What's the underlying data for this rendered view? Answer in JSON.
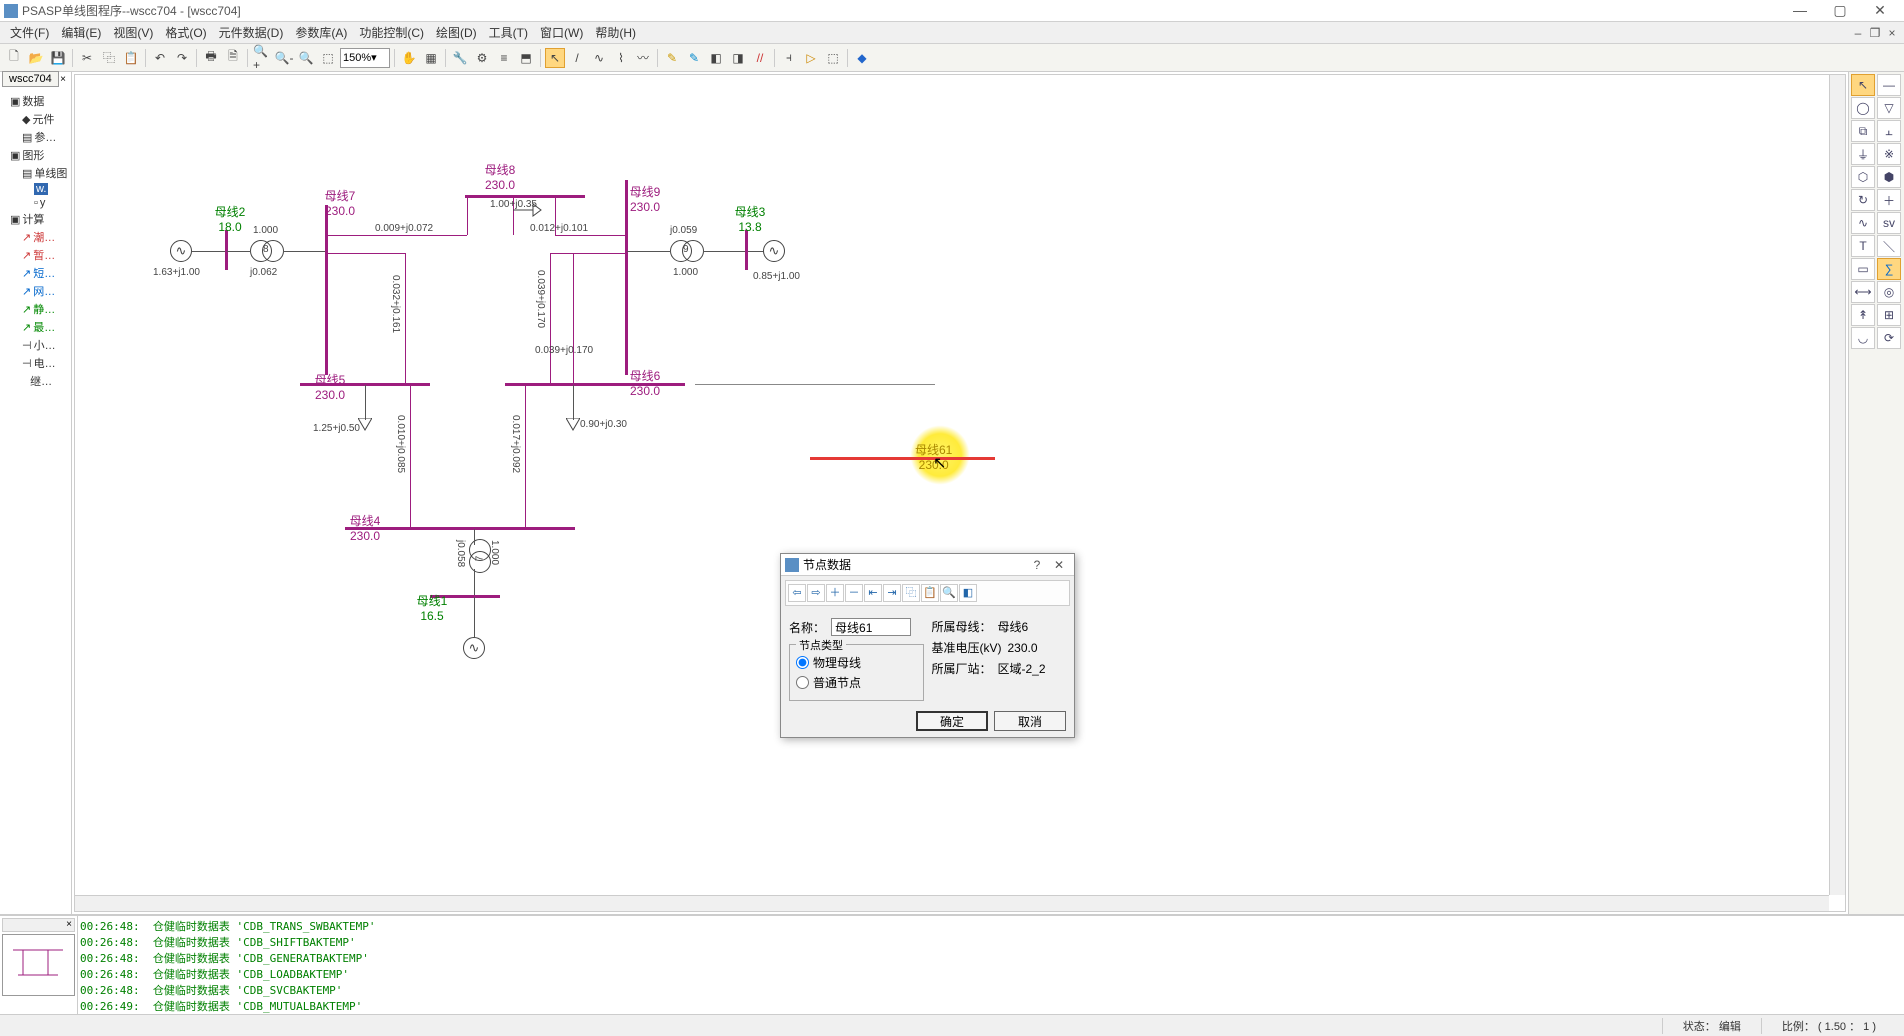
{
  "title": "PSASP单线图程序--wscc704 - [wscc704]",
  "menu": [
    "文件(F)",
    "编辑(E)",
    "视图(V)",
    "格式(O)",
    "元件数据(D)",
    "参数库(A)",
    "功能控制(C)",
    "绘图(D)",
    "工具(T)",
    "窗口(W)",
    "帮助(H)"
  ],
  "zoom": "150%",
  "sidebar_tab": "wscc704",
  "tree": {
    "n_data": "数据",
    "n_yuanjian": "元件",
    "n_can": "参…",
    "n_tuxing": "图形",
    "n_danxian": "单线图",
    "n_w": "w.",
    "n_y": "y",
    "n_jisuan": "计算",
    "leaf1": "潮…",
    "leaf2": "暂…",
    "leaf3": "短…",
    "leaf4": "网…",
    "leaf5": "静…",
    "leaf6": "最…",
    "leaf7": "小…",
    "leaf8": "电…",
    "leaf9": "继…"
  },
  "buses": {
    "b1": {
      "name": "母线1",
      "v": "16.5"
    },
    "b2": {
      "name": "母线2",
      "v": "18.0"
    },
    "b3": {
      "name": "母线3",
      "v": "13.8"
    },
    "b4": {
      "name": "母线4",
      "v": "230.0"
    },
    "b5": {
      "name": "母线5",
      "v": "230.0"
    },
    "b6": {
      "name": "母线6",
      "v": "230.0"
    },
    "b7": {
      "name": "母线7",
      "v": "230.0"
    },
    "b8": {
      "name": "母线8",
      "v": "230.0"
    },
    "b9": {
      "name": "母线9",
      "v": "230.0"
    },
    "b61": {
      "name": "母线61",
      "v": "230.0"
    }
  },
  "labels": {
    "g2": "1.63+j1.00",
    "g3": "0.85+j1.00",
    "x8": "j0.062",
    "x8u": "1.000",
    "x9": "j0.059",
    "x9u": "1.000",
    "x7": "j0.058",
    "x7u": "1.000",
    "ln78": "0.009+j0.072",
    "ln89_a": "1.00+j0.35",
    "ln89": "0.012+j0.101",
    "ln75": "0.032+j0.161",
    "ln96a": "0.039+j0.170",
    "ln96b": "0.039+j0.170",
    "ln54": "0.010+j0.085",
    "ln64": "0.017+j0.092",
    "ld5": "1.25+j0.50",
    "ld6": "0.90+j0.30",
    "t8": "8",
    "t9": "9",
    "t7": "7"
  },
  "dialog": {
    "title": "节点数据",
    "name_lbl": "名称：",
    "name_val": "母线61",
    "group": "节点类型",
    "opt1": "物理母线",
    "opt2": "普通节点",
    "bus_lbl": "所属母线：",
    "bus_val": "母线6",
    "kv_lbl": "基准电压(kV)",
    "kv_val": "230.0",
    "area_lbl": "所属厂站：",
    "area_val": "区域-2_2",
    "ok": "确定",
    "cancel": "取消"
  },
  "log": [
    "00:26:48:  仓健临时数据表 'CDB_TRANS_SWBAKTEMP'",
    "00:26:48:  仓健临时数据表 'CDB_SHIFTBAKTEMP'",
    "00:26:48:  仓健临时数据表 'CDB_GENERATBAKTEMP'",
    "00:26:48:  仓健临时数据表 'CDB_LOADBAKTEMP'",
    "00:26:48:  仓健临时数据表 'CDB_SVCBAKTEMP'",
    "00:26:49:  仓健临时数据表 'CDB_MUTUALBAKTEMP'"
  ],
  "status": {
    "state_lbl": "状态：",
    "state": "编辑",
    "ratio_lbl": "比例：",
    "ratio": "( 1.50 ： 1 )"
  }
}
